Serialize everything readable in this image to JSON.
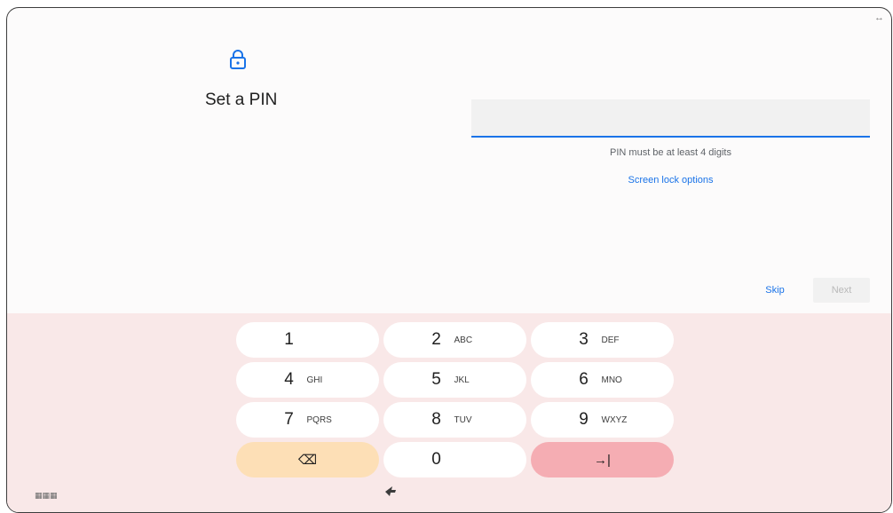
{
  "window": {
    "resize_icon": "↔"
  },
  "setup": {
    "icon": "lock-icon",
    "title": "Set a PIN",
    "pin_input": {
      "value": "",
      "placeholder": ""
    },
    "helper_text": "PIN must be at least 4 digits",
    "screen_lock_options_label": "Screen lock options",
    "skip_label": "Skip",
    "next_label": "Next"
  },
  "colors": {
    "accent": "#1a73e8",
    "keyboard_bg": "#f9e8e8",
    "backspace_key": "#fddfb6",
    "enter_key": "#f5adb3",
    "disabled_text": "#b9b9b9"
  },
  "keypad": {
    "keys": [
      {
        "digit": "1",
        "letters": ""
      },
      {
        "digit": "2",
        "letters": "ABC"
      },
      {
        "digit": "3",
        "letters": "DEF"
      },
      {
        "digit": "4",
        "letters": "GHI"
      },
      {
        "digit": "5",
        "letters": "JKL"
      },
      {
        "digit": "6",
        "letters": "MNO"
      },
      {
        "digit": "7",
        "letters": "PQRS"
      },
      {
        "digit": "8",
        "letters": "TUV"
      },
      {
        "digit": "9",
        "letters": "WXYZ"
      },
      {
        "digit": "0",
        "letters": ""
      }
    ],
    "backspace_glyph": "⌫",
    "enter_glyph": "→|"
  }
}
